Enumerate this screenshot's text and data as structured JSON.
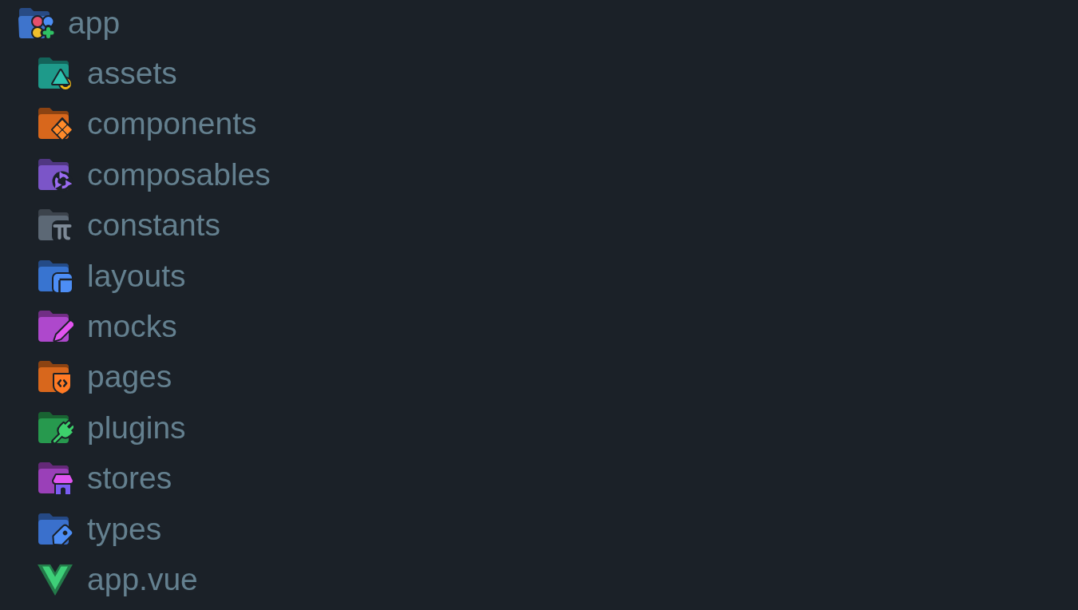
{
  "tree": {
    "label": "app",
    "kind": "folder",
    "expanded": true,
    "color": "#3e74cc",
    "children": [
      {
        "label": "assets",
        "kind": "folder",
        "expanded": false,
        "color": "#1e9a8a"
      },
      {
        "label": "components",
        "kind": "folder",
        "expanded": false,
        "color": "#d8671c"
      },
      {
        "label": "composables",
        "kind": "folder",
        "expanded": false,
        "color": "#7b55c8"
      },
      {
        "label": "constants",
        "kind": "folder",
        "expanded": false,
        "color": "#5c6875"
      },
      {
        "label": "layouts",
        "kind": "folder",
        "expanded": false,
        "color": "#3874d0"
      },
      {
        "label": "mocks",
        "kind": "folder",
        "expanded": false,
        "color": "#ae48cc"
      },
      {
        "label": "pages",
        "kind": "folder",
        "expanded": false,
        "color": "#d8671c"
      },
      {
        "label": "plugins",
        "kind": "folder",
        "expanded": false,
        "color": "#27994e"
      },
      {
        "label": "stores",
        "kind": "folder",
        "expanded": false,
        "color": "#9a40b8"
      },
      {
        "label": "types",
        "kind": "folder",
        "expanded": false,
        "color": "#3a70cc"
      },
      {
        "label": "app.vue",
        "kind": "file"
      }
    ]
  }
}
